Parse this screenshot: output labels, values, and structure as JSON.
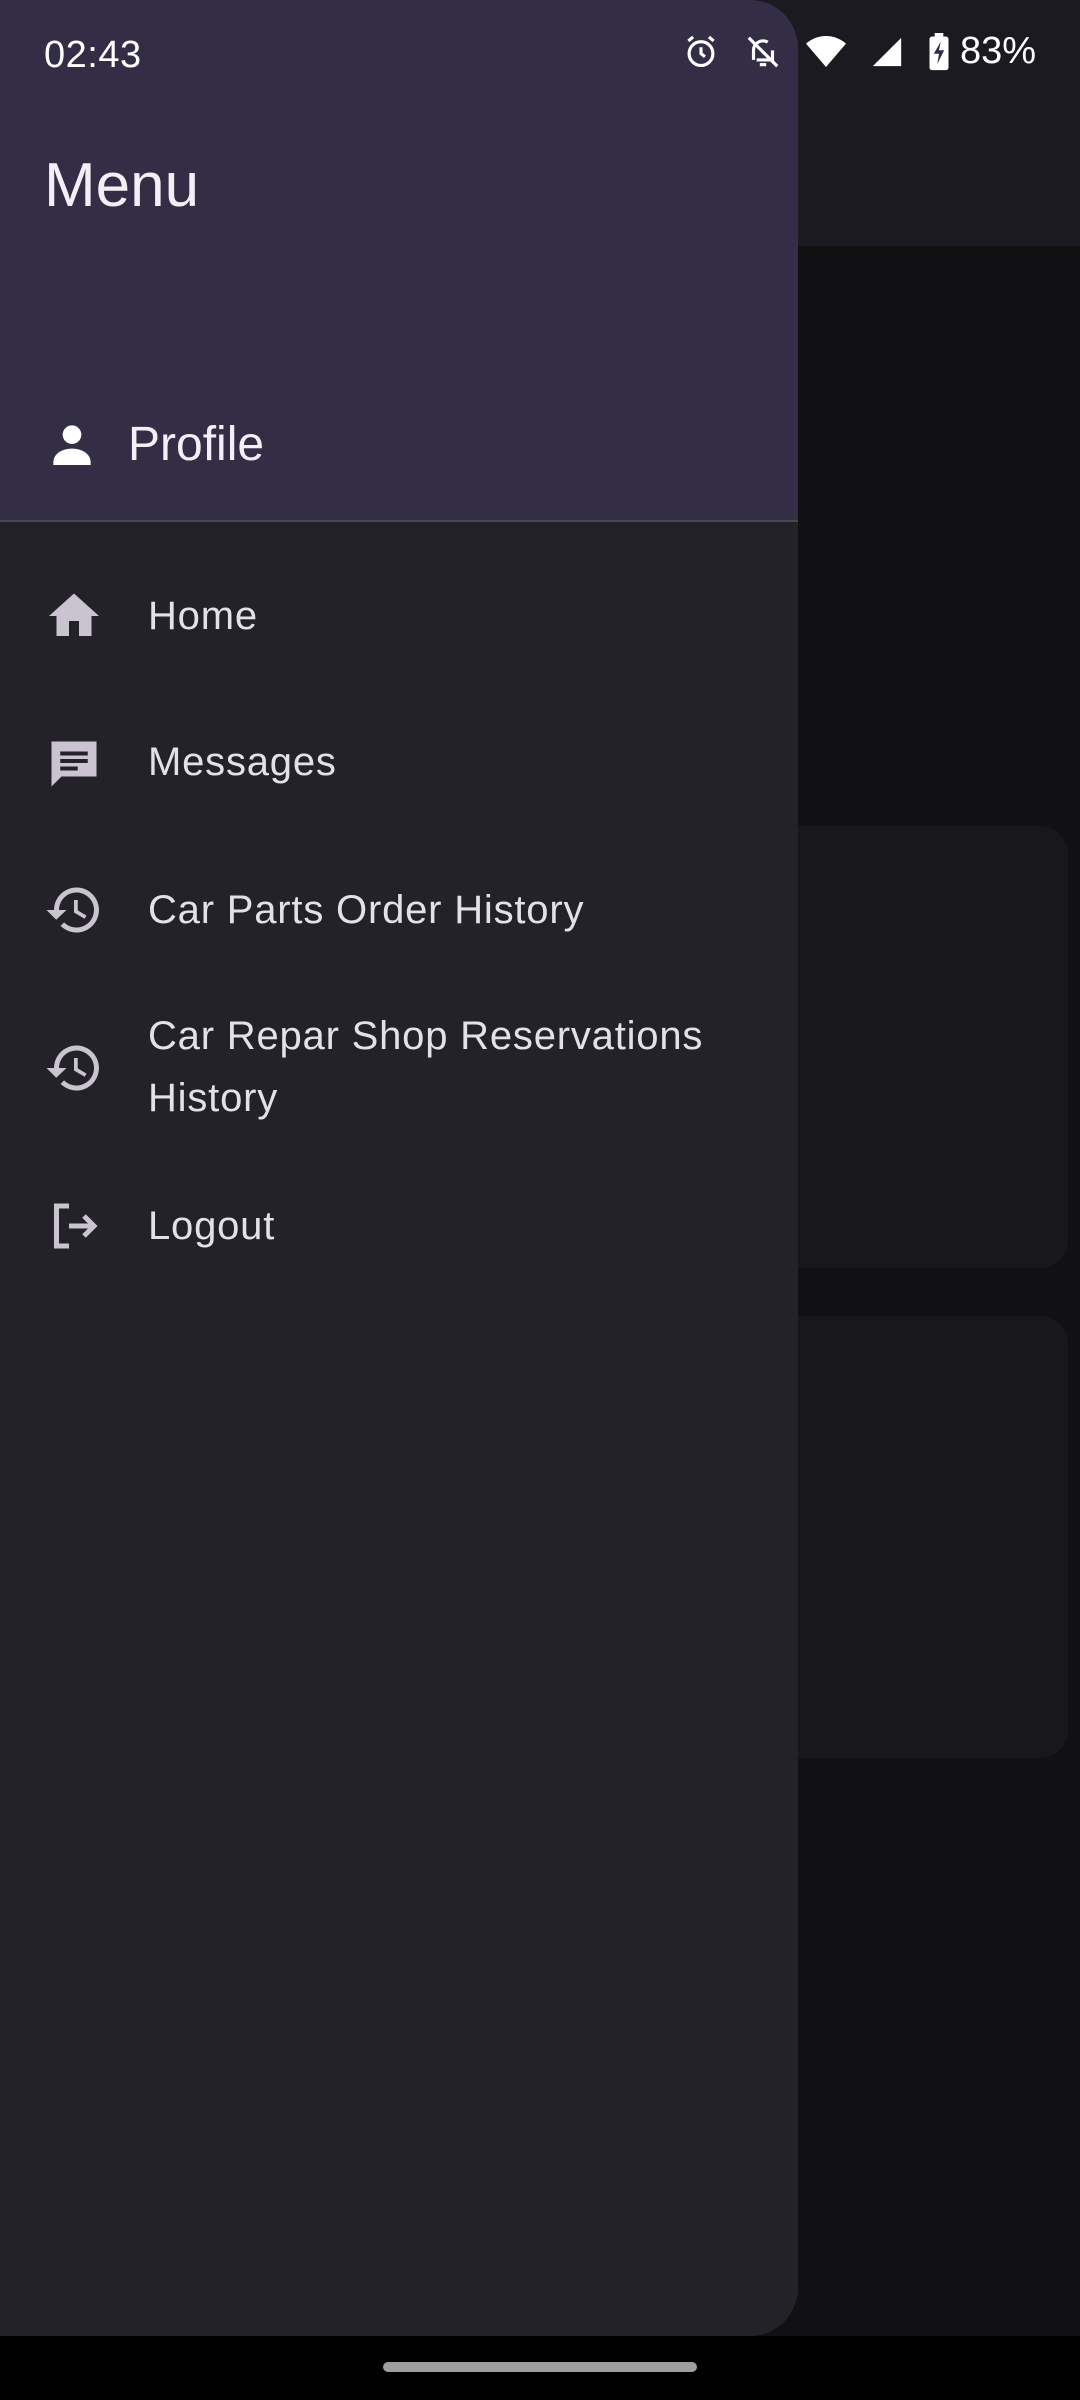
{
  "status_bar": {
    "time": "02:43",
    "battery": "83%",
    "icons": [
      "alarm-icon",
      "notifications-off-icon",
      "wifi-icon",
      "cellular-signal-icon",
      "battery-charging-icon"
    ]
  },
  "drawer": {
    "title": "Menu",
    "profile_label": "Profile",
    "items": [
      {
        "label": "Home",
        "icon": "home-icon"
      },
      {
        "label": "Messages",
        "icon": "message-icon"
      },
      {
        "label": "Car Parts Order History",
        "icon": "history-icon"
      },
      {
        "label": "Car Repar Shop Reservations History",
        "icon": "history-icon"
      },
      {
        "label": "Logout",
        "icon": "logout-icon"
      }
    ]
  },
  "colors": {
    "header_bg": "#332d45",
    "drawer_bg": "#232228",
    "text": "#e4e0ea"
  }
}
